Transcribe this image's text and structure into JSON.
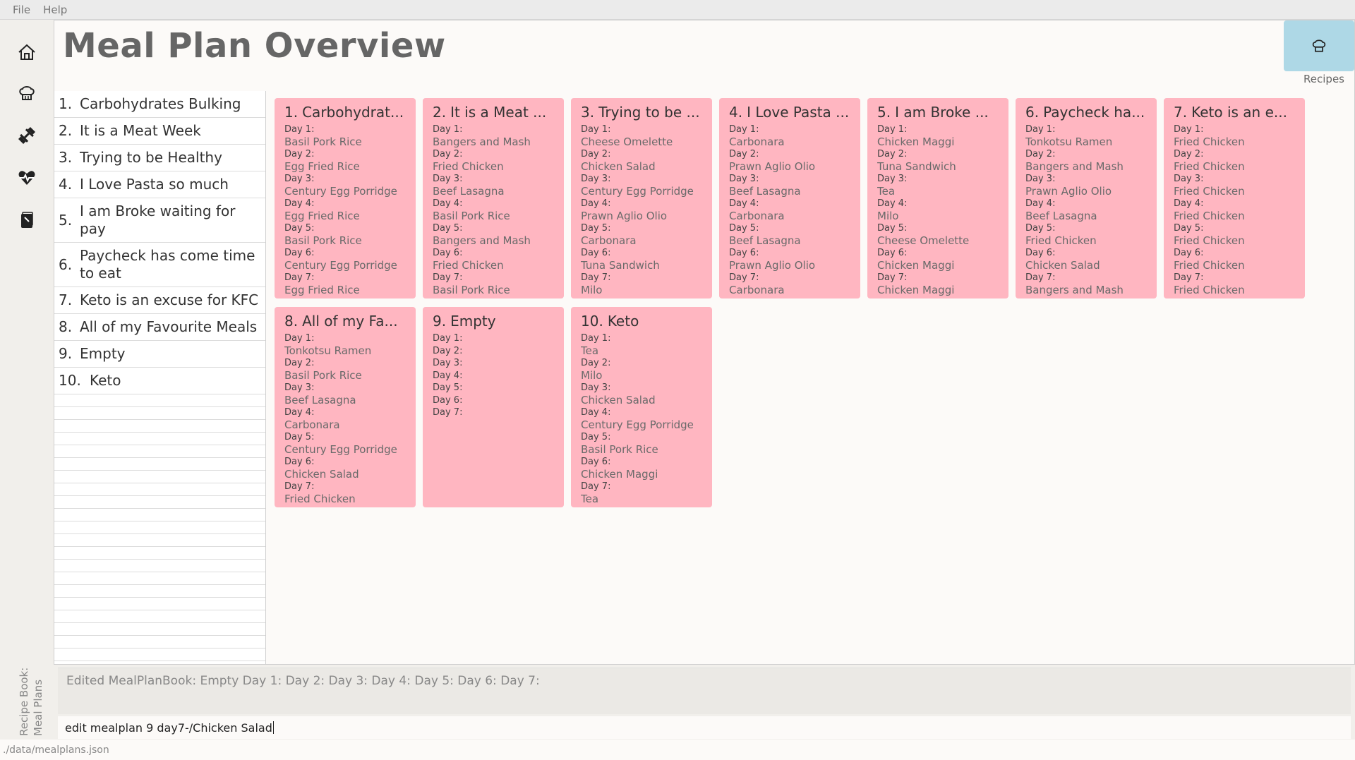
{
  "menu": {
    "file": "File",
    "help": "Help"
  },
  "rail": {
    "icons": [
      "home-icon",
      "chef-hat-icon",
      "dumbbell-icon",
      "heartbeat-icon",
      "recipe-book-icon"
    ],
    "caption_line1": "Recipe Book:",
    "caption_line2": "Meal Plans"
  },
  "header": {
    "title": "Meal Plan Overview",
    "recipes_label": "Recipes"
  },
  "list": [
    {
      "num": "1.",
      "name": "Carbohydrates Bulking"
    },
    {
      "num": "2.",
      "name": "It is a Meat Week"
    },
    {
      "num": "3.",
      "name": "Trying to be Healthy"
    },
    {
      "num": "4.",
      "name": "I Love Pasta so much"
    },
    {
      "num": "5.",
      "name": "I am Broke waiting for pay"
    },
    {
      "num": "6.",
      "name": "Paycheck has come time to eat"
    },
    {
      "num": "7.",
      "name": "Keto is an excuse for KFC"
    },
    {
      "num": "8.",
      "name": "All of my Favourite Meals"
    },
    {
      "num": "9.",
      "name": "Empty"
    },
    {
      "num": "10.",
      "name": "Keto"
    }
  ],
  "day_labels": [
    "Day 1:",
    "Day 2:",
    "Day 3:",
    "Day 4:",
    "Day 5:",
    "Day 6:",
    "Day 7:"
  ],
  "cards": [
    {
      "num": "1.",
      "title": "Carbohydrat...",
      "days": [
        "Basil Pork Rice",
        "Egg Fried Rice",
        "Century Egg Porridge",
        "Egg Fried Rice",
        "Basil Pork Rice",
        "Century Egg Porridge",
        "Egg Fried Rice"
      ]
    },
    {
      "num": "2.",
      "title": "It is a Meat ...",
      "days": [
        "Bangers and Mash",
        "Fried Chicken",
        "Beef Lasagna",
        "Basil Pork Rice",
        "Bangers and Mash",
        "Fried Chicken",
        "Basil Pork Rice"
      ]
    },
    {
      "num": "3.",
      "title": "Trying to be ...",
      "days": [
        "Cheese Omelette",
        "Chicken Salad",
        "Century Egg Porridge",
        "Prawn Aglio Olio",
        "Carbonara",
        "Tuna Sandwich",
        "Milo"
      ]
    },
    {
      "num": "4.",
      "title": "I Love Pasta ...",
      "days": [
        "Carbonara",
        "Prawn Aglio Olio",
        "Beef Lasagna",
        "Carbonara",
        "Beef Lasagna",
        "Prawn Aglio Olio",
        "Carbonara"
      ]
    },
    {
      "num": "5.",
      "title": "I am Broke ...",
      "days": [
        "Chicken Maggi",
        "Tuna Sandwich",
        "Tea",
        "Milo",
        "Cheese Omelette",
        "Chicken Maggi",
        "Chicken Maggi"
      ]
    },
    {
      "num": "6.",
      "title": "Paycheck ha...",
      "days": [
        "Tonkotsu Ramen",
        "Bangers and Mash",
        "Prawn Aglio Olio",
        "Beef Lasagna",
        "Fried Chicken",
        "Chicken Salad",
        "Bangers and Mash"
      ]
    },
    {
      "num": "7.",
      "title": "Keto is an e...",
      "days": [
        "Fried Chicken",
        "Fried Chicken",
        "Fried Chicken",
        "Fried Chicken",
        "Fried Chicken",
        "Fried Chicken",
        "Fried Chicken"
      ]
    },
    {
      "num": "8.",
      "title": "All of my Fa...",
      "days": [
        "Tonkotsu Ramen",
        "Basil Pork Rice",
        "Beef Lasagna",
        "Carbonara",
        "Century Egg Porridge",
        "Chicken Salad",
        "Fried Chicken"
      ]
    },
    {
      "num": "9.",
      "title": "Empty",
      "days": [
        "",
        "",
        "",
        "",
        "",
        "",
        ""
      ]
    },
    {
      "num": "10.",
      "title": "Keto",
      "days": [
        "Tea",
        "Milo",
        "Chicken Salad",
        "Century Egg Porridge",
        "Basil Pork Rice",
        "Chicken Maggi",
        "Tea"
      ]
    }
  ],
  "result": "Edited MealPlanBook: Empty Day 1:  Day 2:  Day 3:  Day 4:  Day 5:  Day 6:  Day 7:",
  "command": "edit mealplan 9 day7-/Chicken Salad",
  "status": "./data/mealplans.json"
}
